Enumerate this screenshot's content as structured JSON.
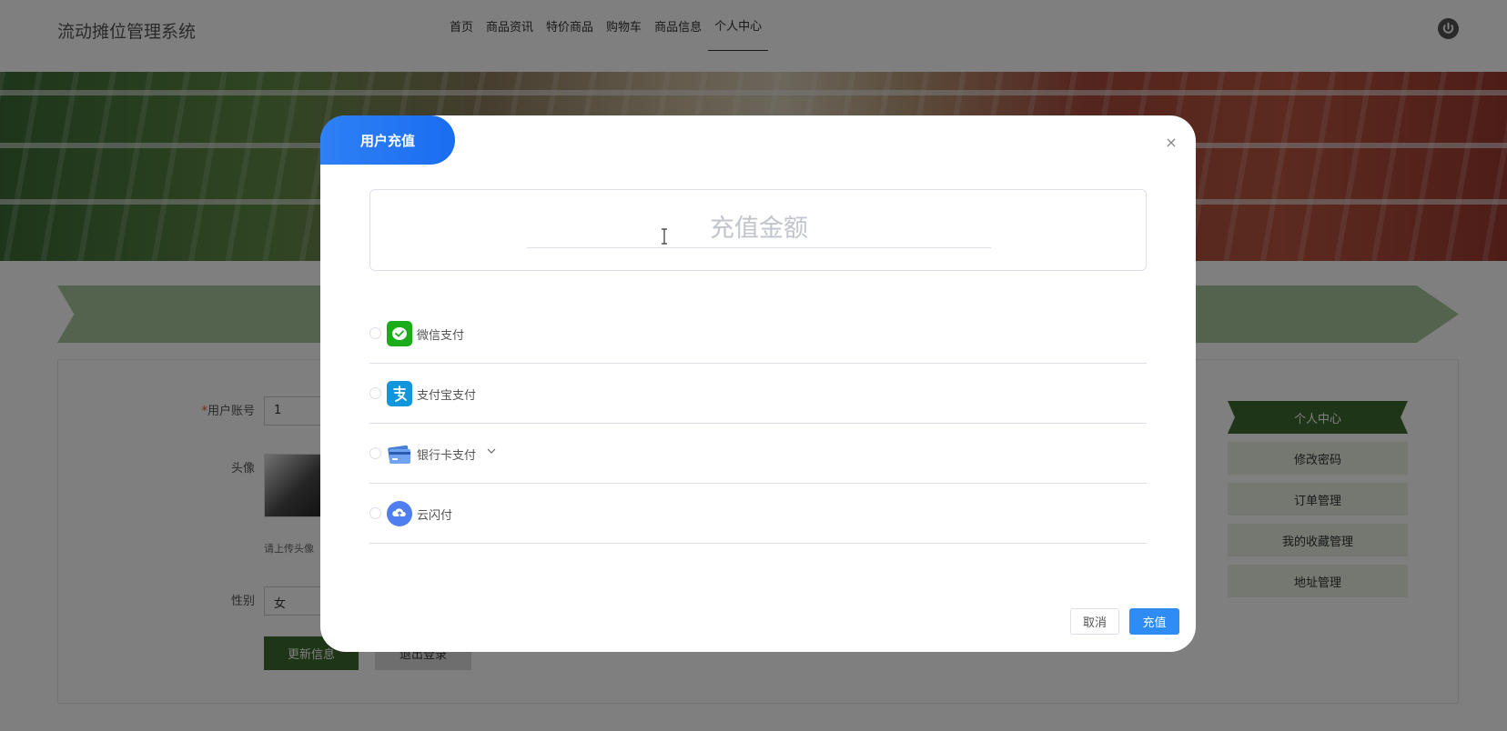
{
  "header": {
    "app_title": "流动摊位管理系统",
    "nav": [
      "首页",
      "商品资讯",
      "特价商品",
      "购物车",
      "商品信息",
      "个人中心"
    ],
    "active_index": 5
  },
  "form": {
    "account_label": "用户账号",
    "account_value": "1",
    "avatar_label": "头像",
    "upload_tip": "请上传头像",
    "gender_label": "性别",
    "gender_value": "女",
    "update_button": "更新信息",
    "logout_button": "退出登录"
  },
  "side_menu": {
    "items": [
      "个人中心",
      "修改密码",
      "订单管理",
      "我的收藏管理",
      "地址管理"
    ]
  },
  "modal": {
    "title": "用户充值",
    "close": "×",
    "amount_placeholder": "充值金额",
    "payment_methods": [
      {
        "label": "微信支付",
        "icon": "wechat-pay-icon",
        "color": "#1aad19"
      },
      {
        "label": "支付宝支付",
        "icon": "alipay-icon",
        "color": "#1296db"
      },
      {
        "label": "银行卡支付",
        "icon": "bank-card-icon",
        "color": "#4a7fd6"
      },
      {
        "label": "云闪付",
        "icon": "union-quickpass-icon",
        "color": "#4e7ef0"
      }
    ],
    "cancel_button": "取消",
    "recharge_button": "充值"
  },
  "colors": {
    "accent_blue": "#2f8cf5",
    "brand_green": "#3d6a2f"
  }
}
